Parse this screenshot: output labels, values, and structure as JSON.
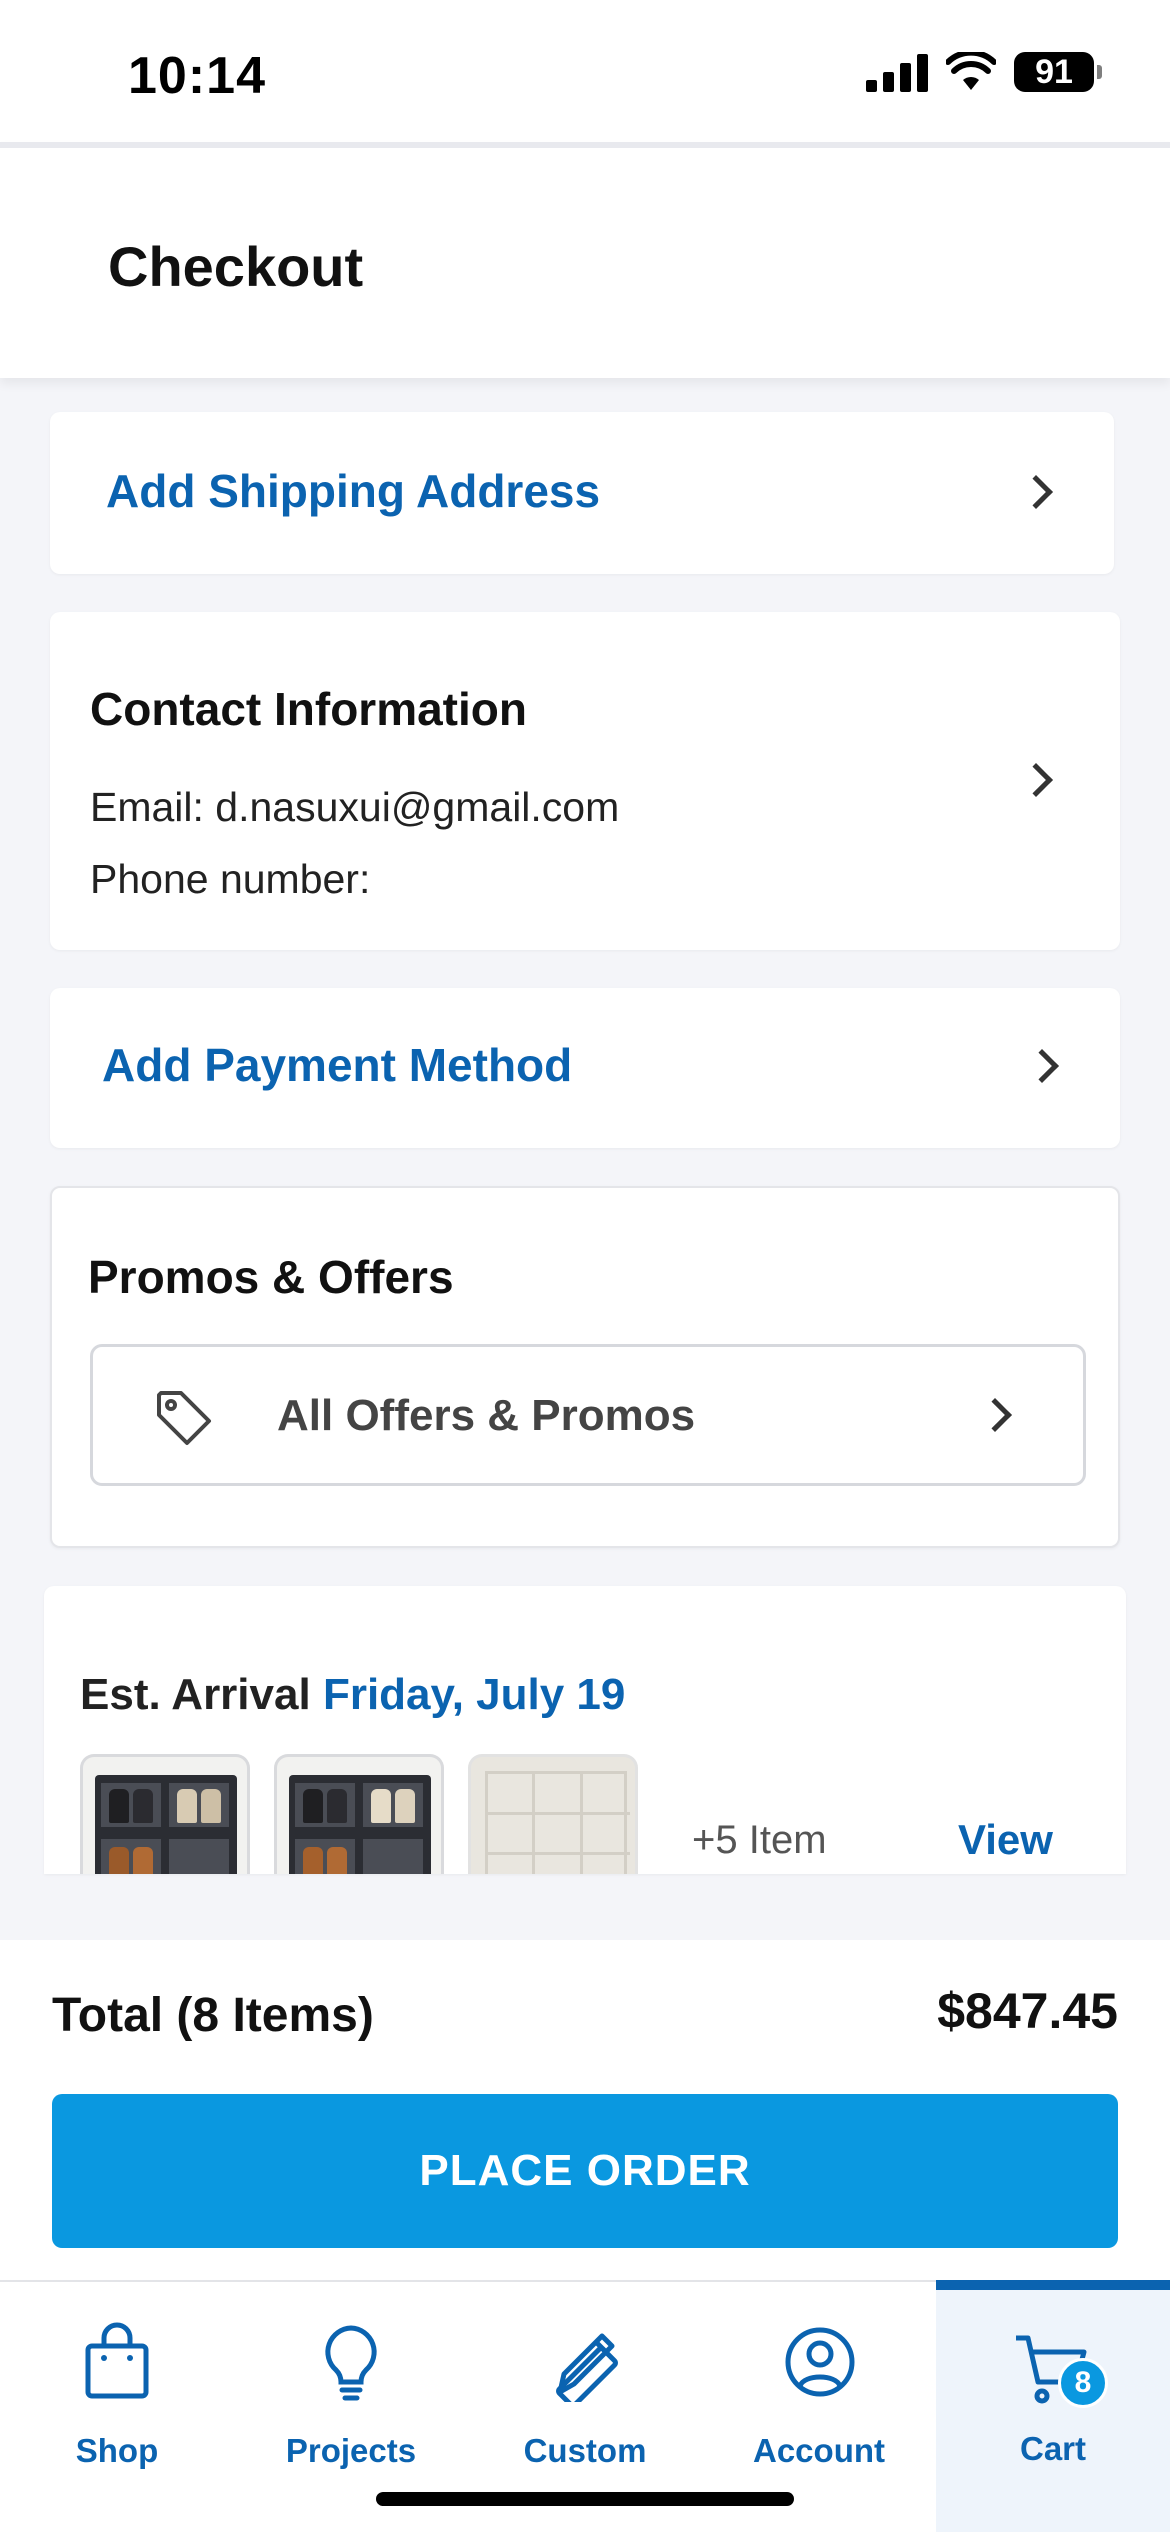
{
  "status": {
    "time": "10:14",
    "battery": "91"
  },
  "header": {
    "title": "Checkout"
  },
  "shipping": {
    "label": "Add Shipping Address"
  },
  "contact": {
    "title": "Contact Information",
    "email_line": "Email: d.nasuxui@gmail.com",
    "phone_line": "Phone number:"
  },
  "payment": {
    "label": "Add Payment Method"
  },
  "promos": {
    "title": "Promos & Offers",
    "button_label": "All Offers & Promos"
  },
  "arrival": {
    "prefix": "Est. Arrival",
    "date": "Friday, July 19",
    "more_items": "+5 Item",
    "view_label": "View"
  },
  "order": {
    "total_label": "Total (8 Items)",
    "total_value": "$847.45",
    "place_order_label": "PLACE ORDER"
  },
  "tabbar": {
    "items": [
      {
        "label": "Shop",
        "icon": "shopping-bag-icon"
      },
      {
        "label": "Projects",
        "icon": "lightbulb-icon"
      },
      {
        "label": "Custom",
        "icon": "pencil-ruler-icon"
      },
      {
        "label": "Account",
        "icon": "user-circle-icon"
      },
      {
        "label": "Cart",
        "icon": "cart-icon",
        "badge": "8",
        "active": true
      }
    ]
  },
  "colors": {
    "link_blue": "#0b63b0",
    "button_blue": "#0a98e0",
    "background": "#f4f5f9"
  }
}
